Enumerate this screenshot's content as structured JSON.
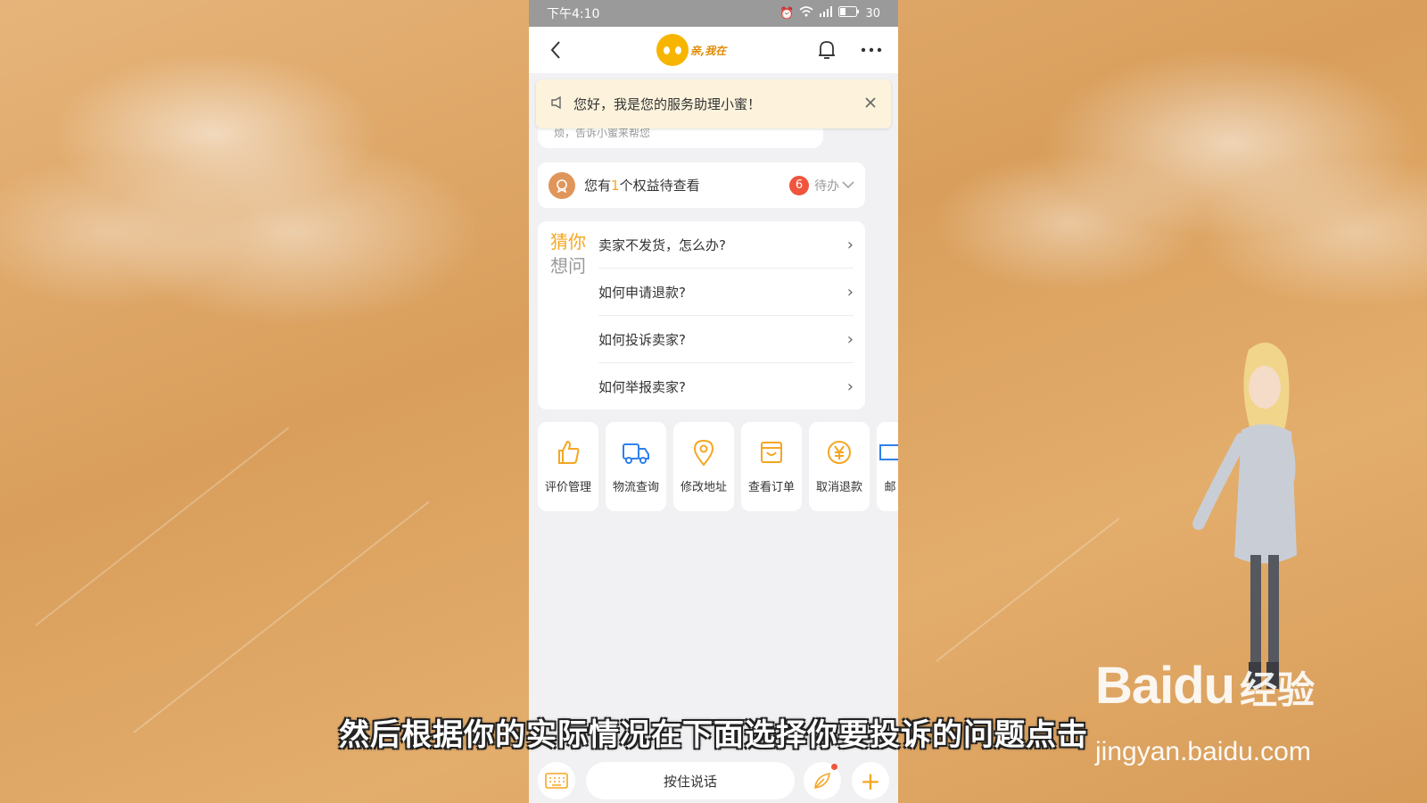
{
  "status_bar": {
    "time": "下午4:10",
    "battery": "30"
  },
  "nav": {
    "logo_text": "亲,我在"
  },
  "notice": {
    "text": "您好，我是您的服务助理小蜜！"
  },
  "greeting_partial": "烦，告诉小蜜来帮您",
  "benefit": {
    "prefix": "您有",
    "count": "1",
    "suffix": "个权益待查看",
    "badge": "6",
    "todo": "待办"
  },
  "faq": {
    "label_line1": "猜你",
    "label_line2": "想问",
    "items": [
      {
        "text": "卖家不发货，怎么办?"
      },
      {
        "text": "如何申请退款?"
      },
      {
        "text": "如何投诉卖家?"
      },
      {
        "text": "如何举报卖家?"
      }
    ]
  },
  "tools": [
    {
      "label": "评价管理",
      "icon": "thumbs-up-icon"
    },
    {
      "label": "物流查询",
      "icon": "truck-icon"
    },
    {
      "label": "修改地址",
      "icon": "location-pin-icon"
    },
    {
      "label": "查看订单",
      "icon": "order-box-icon"
    },
    {
      "label": "取消退款",
      "icon": "yen-refund-icon"
    },
    {
      "label": "邮",
      "icon": "mail-icon"
    }
  ],
  "bottom": {
    "hold_to_talk": "按住说话"
  },
  "subtitle": "然后根据你的实际情况在下面选择你要投诉的问题点击",
  "watermark": {
    "logo": "Baidu",
    "jingyan": "经验",
    "url": "jingyan.baidu.com"
  },
  "colors": {
    "accent": "#f5a623",
    "badge": "#f0543c",
    "notice_bg": "#fdf3dc"
  }
}
